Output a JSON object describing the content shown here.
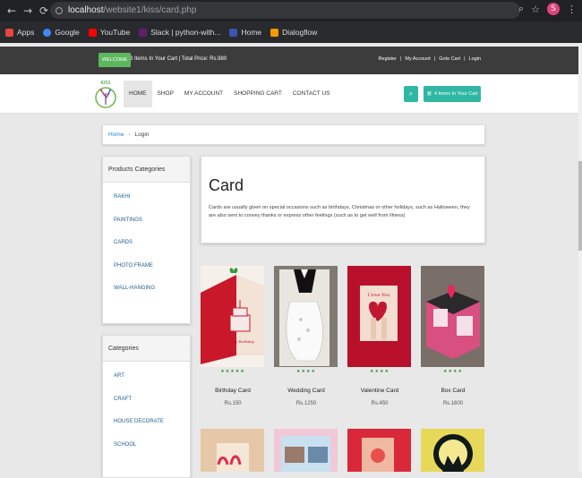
{
  "browser": {
    "url_host": "localhost",
    "url_path": "/website1/kiss/card.php",
    "profile_initial": "S",
    "bookmarks": [
      {
        "label": "Apps",
        "color": "#e8453c"
      },
      {
        "label": "Google",
        "color": "#4285f4"
      },
      {
        "label": "YouTube",
        "color": "#ff0000"
      },
      {
        "label": "Slack | python-with...",
        "color": "#611f69"
      },
      {
        "label": "Home",
        "color": "#3f51b5"
      },
      {
        "label": "Dialogflow",
        "color": "#ff9800"
      }
    ]
  },
  "topbar": {
    "welcome": "WELCOME",
    "cart_info": "3 Items In Your Cart | Total Price: Rs.980",
    "links": [
      "Register",
      "|",
      "My Account",
      "|",
      "Goto Cart",
      "|",
      "Login"
    ]
  },
  "nav": {
    "logo_text": "KISS",
    "items": [
      "HOME",
      "SHOP",
      "MY ACCOUNT",
      "SHOPPING CART",
      "CONTACT US"
    ],
    "cart_button": "4 Items In Your Cart"
  },
  "breadcrumb": {
    "home": "Home",
    "current": "Login"
  },
  "product_categories": {
    "title": "Products Categories",
    "items": [
      "RAKHI",
      "PAINTINGS",
      "CARDS",
      "PHOTO FRAME",
      "WALL-HANGING"
    ]
  },
  "categories": {
    "title": "Categories",
    "items": [
      "ART",
      "CRAFT",
      "HOUSE DECORATE",
      "SCHOOL"
    ]
  },
  "intro": {
    "title": "Card",
    "text": "Cards are usually given on special occasions such as birthdays, Christmas or other holidays, such as Halloween, they are also sent to convey thanks or express other feelings (such as to get well from illness)"
  },
  "products": [
    {
      "name": "Birthday Card",
      "price": "Rs.150",
      "stars": "★★★★★",
      "color": "#c8182a"
    },
    {
      "name": "Wedding Card",
      "price": "Rs.1250",
      "stars": "★★★★",
      "color": "#8a8276"
    },
    {
      "name": "Valentine Card",
      "price": "Rs.450",
      "stars": "★★★★",
      "color": "#b8102a"
    },
    {
      "name": "Box Card",
      "price": "Rs.1600",
      "stars": "★★★★",
      "color": "#d85080"
    }
  ]
}
